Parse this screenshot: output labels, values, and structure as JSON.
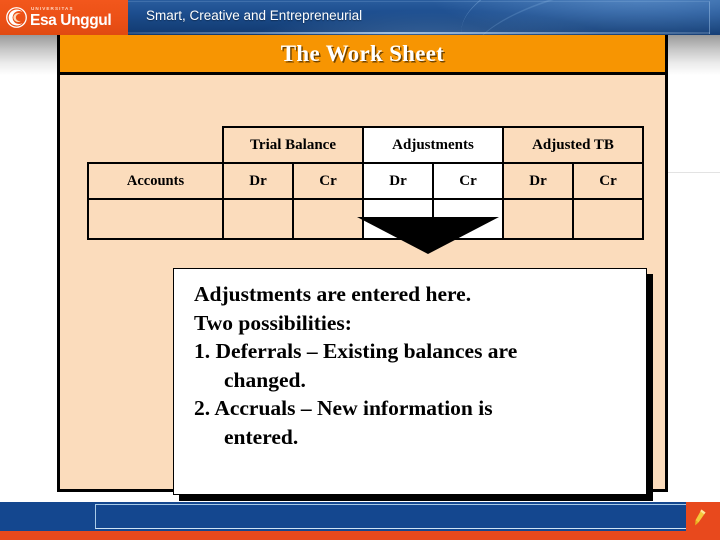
{
  "header": {
    "logo": {
      "icon": "swirl-circle-logo-icon",
      "university_label": "UNIVERSITAS",
      "name": "Esa Unggul"
    },
    "tagline": "Smart, Creative and Entrepreneurial"
  },
  "slide": {
    "title": "The Work Sheet",
    "worksheet": {
      "group_headers": [
        "",
        "Trial Balance",
        "Adjustments",
        "Adjusted TB"
      ],
      "column_headers": [
        "Accounts",
        "Dr",
        "Cr",
        "Dr",
        "Cr",
        "Dr",
        "Cr"
      ],
      "body_rows": [
        [
          "",
          "",
          "",
          "",
          "",
          "",
          ""
        ]
      ],
      "highlighted_group": "Adjustments"
    },
    "callout": {
      "tail": "callout-tail-pointing-to-adjustments",
      "lines": [
        "Adjustments are entered here.",
        "Two possibilities:",
        "1. Deferrals – Existing balances are",
        "changed.",
        "2. Accruals – New information is",
        "entered."
      ]
    }
  },
  "footer": {
    "accent_icon": "pencil-icon"
  },
  "colors": {
    "banner_blue": "#1d4e8f",
    "logo_orange": "#ec5016",
    "title_orange": "#f79502",
    "slide_peach": "#fbdcbc",
    "footer_blue": "#14478f",
    "footer_orange": "#e8491d",
    "callout_white": "#ffffff",
    "border_black": "#000000"
  }
}
